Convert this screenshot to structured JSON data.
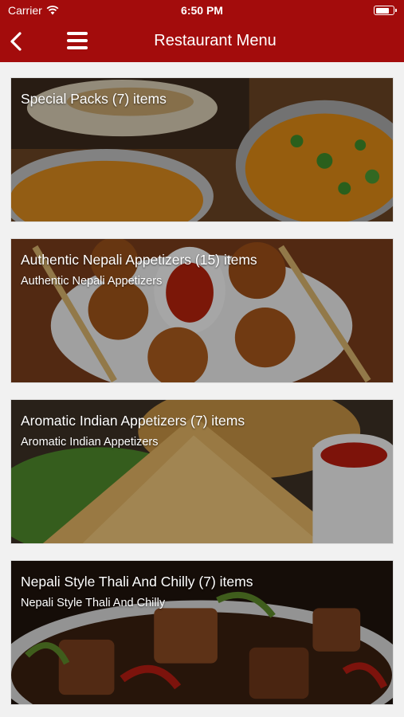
{
  "status_bar": {
    "carrier": "Carrier",
    "time": "6:50 PM"
  },
  "navbar": {
    "title": "Restaurant Menu"
  },
  "categories": [
    {
      "title": "Special Packs (7) items",
      "subtitle": ""
    },
    {
      "title": "Authentic Nepali Appetizers (15) items",
      "subtitle": "Authentic Nepali Appetizers"
    },
    {
      "title": "Aromatic Indian Appetizers (7) items",
      "subtitle": "Aromatic Indian Appetizers"
    },
    {
      "title": "Nepali Style Thali And Chilly (7) items",
      "subtitle": "Nepali Style Thali And Chilly"
    }
  ],
  "colors": {
    "header": "#a30c0c",
    "background": "#f1f1f1"
  }
}
